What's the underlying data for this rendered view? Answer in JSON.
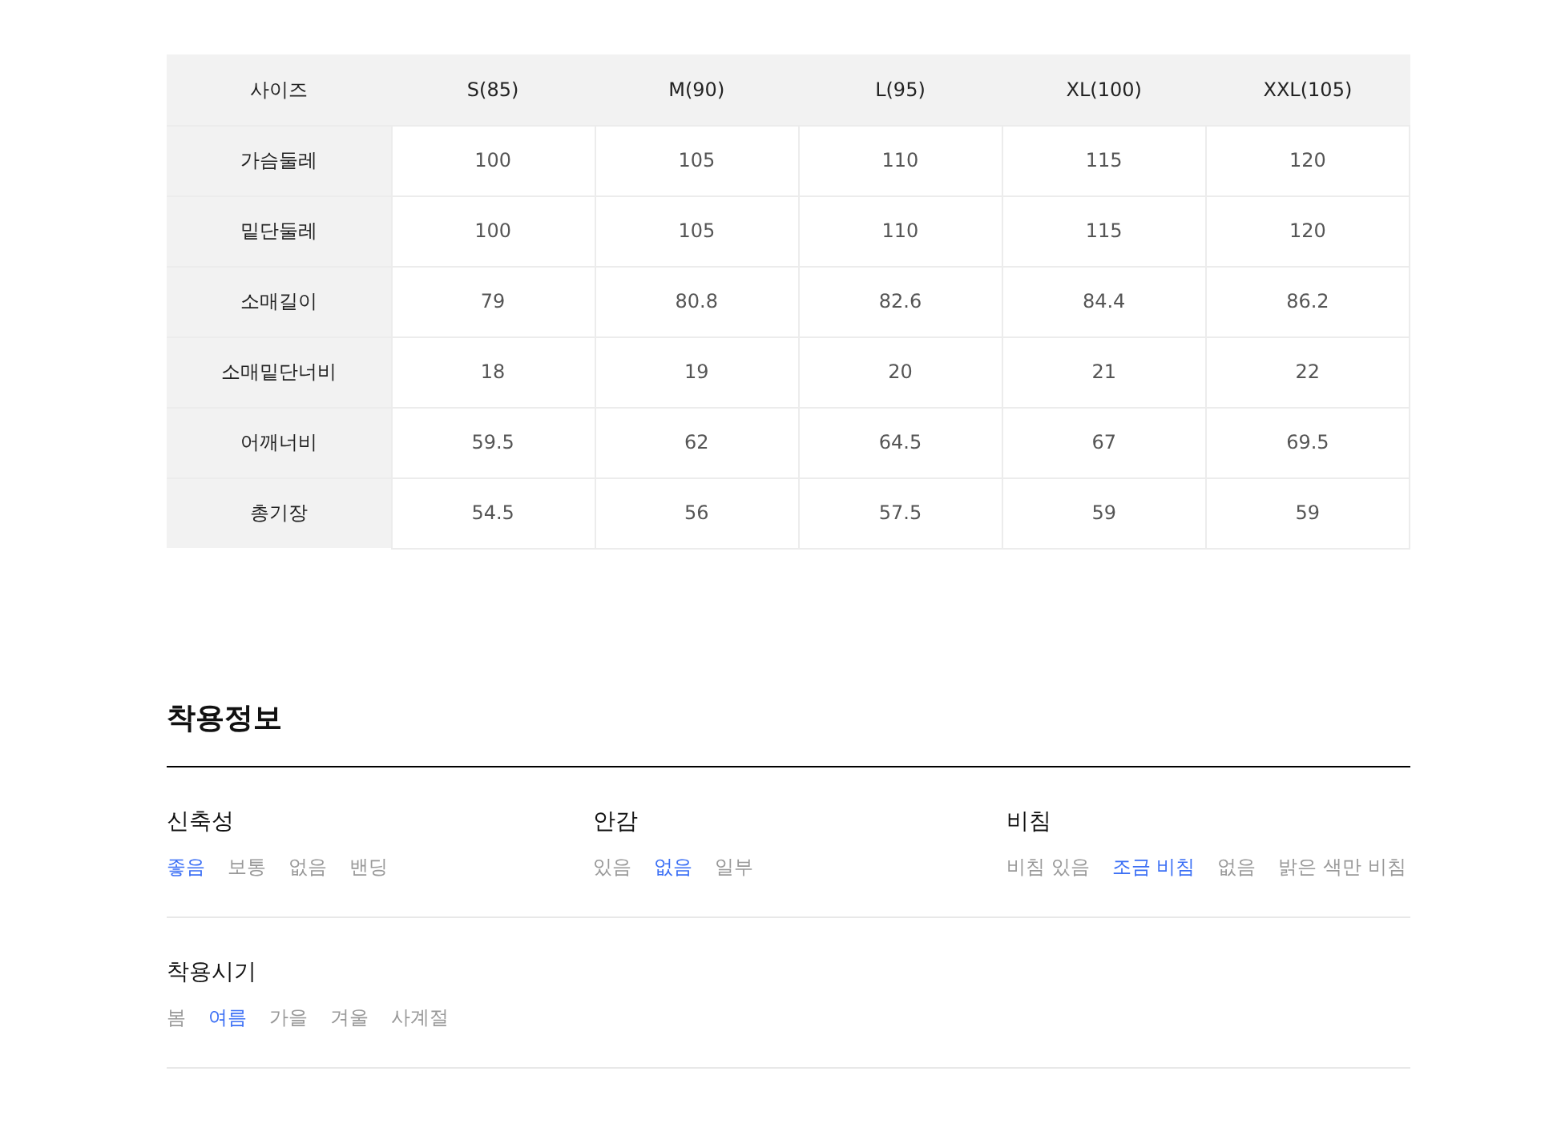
{
  "size_table": {
    "columns": [
      "사이즈",
      "S(85)",
      "M(90)",
      "L(95)",
      "XL(100)",
      "XXL(105)"
    ],
    "rows": [
      [
        "가슴둘레",
        "100",
        "105",
        "110",
        "115",
        "120"
      ],
      [
        "밑단둘레",
        "100",
        "105",
        "110",
        "115",
        "120"
      ],
      [
        "소매길이",
        "79",
        "80.8",
        "82.6",
        "84.4",
        "86.2"
      ],
      [
        "소매밑단너비",
        "18",
        "19",
        "20",
        "21",
        "22"
      ],
      [
        "어깨너비",
        "59.5",
        "62",
        "64.5",
        "67",
        "69.5"
      ],
      [
        "총기장",
        "54.5",
        "56",
        "57.5",
        "59",
        "59"
      ]
    ]
  },
  "fit_info": {
    "title": "착용정보",
    "groups": [
      [
        {
          "label": "신축성",
          "options": [
            {
              "text": "좋음",
              "selected": true
            },
            {
              "text": "보통",
              "selected": false
            },
            {
              "text": "없음",
              "selected": false
            },
            {
              "text": "밴딩",
              "selected": false
            }
          ]
        },
        {
          "label": "안감",
          "options": [
            {
              "text": "있음",
              "selected": false
            },
            {
              "text": "없음",
              "selected": true
            },
            {
              "text": "일부",
              "selected": false
            }
          ]
        },
        {
          "label": "비침",
          "options": [
            {
              "text": "비침 있음",
              "selected": false
            },
            {
              "text": "조금 비침",
              "selected": true
            },
            {
              "text": "없음",
              "selected": false
            },
            {
              "text": "밝은 색만 비침",
              "selected": false
            }
          ]
        }
      ],
      [
        {
          "label": "착용시기",
          "options": [
            {
              "text": "봄",
              "selected": false
            },
            {
              "text": "여름",
              "selected": true
            },
            {
              "text": "가을",
              "selected": false
            },
            {
              "text": "겨울",
              "selected": false
            },
            {
              "text": "사계절",
              "selected": false
            }
          ]
        }
      ]
    ]
  }
}
